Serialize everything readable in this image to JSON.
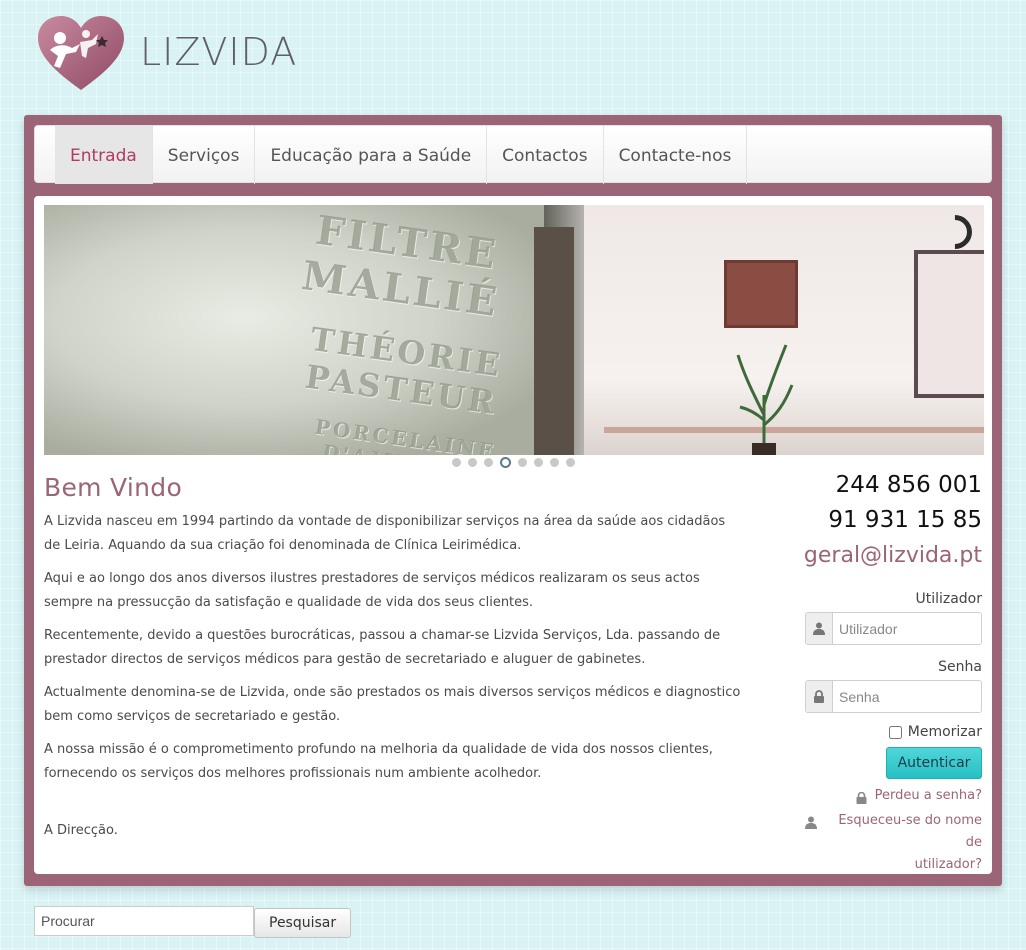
{
  "brand": {
    "name": "LIZVIDA"
  },
  "nav": {
    "items": [
      {
        "label": "Entrada",
        "active": true
      },
      {
        "label": "Serviços"
      },
      {
        "label": "Educação para a Saúde"
      },
      {
        "label": "Contactos"
      },
      {
        "label": "Contacte-nos"
      }
    ]
  },
  "slideshow": {
    "engraving": [
      "FILTRE MALLIÉ",
      "THÉORIE PASTEUR",
      "PORCELAINE D'AMIANTE"
    ],
    "dot_count": 8,
    "active_dot": 4
  },
  "article": {
    "title": "Bem Vindo",
    "paragraphs": [
      "A Lizvida nasceu em 1994 partindo da vontade de disponibilizar serviços na área da saúde aos cidadãos de Leiria. Aquando da sua criação foi denominada de Clínica Leirimédica.",
      "Aqui e ao longo dos anos diversos  ilustres prestadores de serviços médicos realizaram os seus actos sempre na pressucção da satisfação e qualidade de vida dos seus clientes.",
      "Recentemente, devido a questões burocráticas, passou a chamar-se Lizvida Serviços, Lda. passando de prestador directos de serviços médicos para gestão de secretariado e aluguer de gabinetes.",
      "Actualmente denomina-se de Lizvida, onde são prestados os mais diversos serviços médicos e diagnostico bem como serviços de secretariado e gestão.",
      "A nossa missão é o comprometimento profundo na melhoria da qualidade de vida dos nossos clientes, fornecendo os serviços dos melhores profissionais num ambiente acolhedor."
    ],
    "signoff": "A Direcção."
  },
  "contact": {
    "phone1": "244 856 001",
    "phone2": "91 931 15 85",
    "email": "geral@lizvida.pt"
  },
  "login": {
    "username_label": "Utilizador",
    "username_placeholder": "Utilizador",
    "password_label": "Senha",
    "password_placeholder": "Senha",
    "remember_label": "Memorizar",
    "submit_label": "Autenticar",
    "forgot_password": "Perdeu a senha?",
    "forgot_username_line1": "Esqueceu-se do nome de",
    "forgot_username_line2": "utilizador?"
  },
  "search": {
    "placeholder": "Procurar",
    "button_label": "Pesquisar"
  },
  "colors": {
    "accent": "#9b6577",
    "nav_active": "#b03a63",
    "button": "#27c0c4",
    "background": "#d9f3f5"
  }
}
